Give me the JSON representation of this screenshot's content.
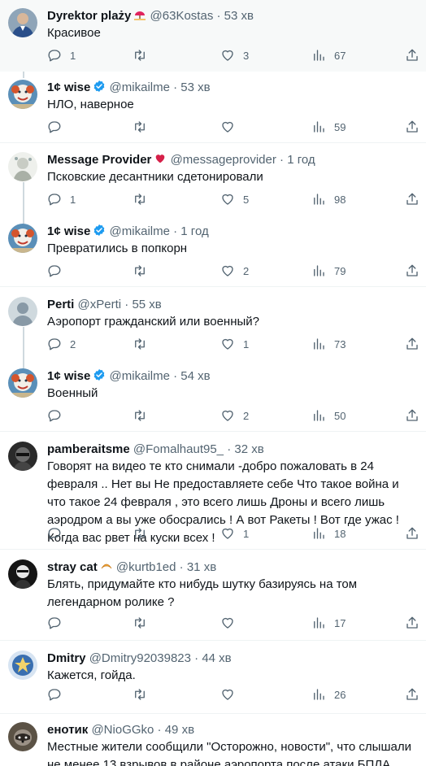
{
  "colors": {
    "accent": "#1d9bf0",
    "text": "#0f1419",
    "muted": "#536471",
    "thread": "#cfd9de",
    "hover": "#f7f9f9"
  },
  "tweets": [
    {
      "name": "Dyrektor plaży",
      "handle": "@63Kostas",
      "time": "53 хв",
      "text": "Красивое",
      "reply": "1",
      "retweet": "",
      "like": "3",
      "views": "67",
      "avatar": "blue-suit-man"
    },
    {
      "name": "1¢ wise",
      "handle": "@mikailme",
      "time": "53 хв",
      "text": "НЛО, наверное",
      "reply": "",
      "retweet": "",
      "like": "",
      "views": "59",
      "avatar": "clown"
    },
    {
      "name": "Message Provider",
      "handle": "@messageprovider",
      "time": "1 год",
      "text": "Псковские десантники сдетонировали",
      "reply": "1",
      "retweet": "",
      "like": "5",
      "views": "98",
      "avatar": "pale-figure"
    },
    {
      "name": "1¢ wise",
      "handle": "@mikailme",
      "time": "1 год",
      "text": "Превратились в попкорн",
      "reply": "",
      "retweet": "",
      "like": "2",
      "views": "79",
      "avatar": "clown"
    },
    {
      "name": "Perti",
      "handle": "@xPerti",
      "time": "55 хв",
      "text": "Аэропорт гражданский или военный?",
      "reply": "2",
      "retweet": "",
      "like": "1",
      "views": "73",
      "avatar": "default"
    },
    {
      "name": "1¢ wise",
      "handle": "@mikailme",
      "time": "54 хв",
      "text": "Военный",
      "reply": "",
      "retweet": "",
      "like": "2",
      "views": "50",
      "avatar": "clown"
    },
    {
      "name": "pamberaitsme",
      "handle": "@Fomalhaut95_",
      "time": "32 хв",
      "text": "Говорят на видео  те кто снимали -добро пожаловать в 24 февраля .. Нет вы Не предоставляете себе Что такое война и что такое 24 февраля , это всего лишь Дроны  и всего лишь аэродром а вы уже обосрались  ! А вот Ракеты ! Вот где ужас ! Когда вас рвет на куски всех !",
      "reply": "",
      "retweet": "",
      "like": "1",
      "views": "18",
      "avatar": "dark-photo"
    },
    {
      "name": "stray cat",
      "handle": "@kurtb1ed",
      "time": "31 хв",
      "text": "Блять, придумайте кто нибудь шутку базируясь на том легендарном ролике ?",
      "reply": "",
      "retweet": "",
      "like": "",
      "views": "17",
      "avatar": "dark-photo"
    },
    {
      "name": "Dmitry",
      "handle": "@Dmitry92039823",
      "time": "44 хв",
      "text": "Кажется, гойда.",
      "reply": "",
      "retweet": "",
      "like": "",
      "views": "26",
      "avatar": "emblem"
    },
    {
      "name": "енотик",
      "handle": "@NioGGko",
      "time": "49 хв",
      "text": "Местные жители сообщили \"Осторожно, новости\", что слышали не менее 13 взрывов в районе аэропорта после атаки БПЛА.",
      "reply": "",
      "retweet": "",
      "like": "",
      "views": "",
      "avatar": "raccoon"
    }
  ]
}
